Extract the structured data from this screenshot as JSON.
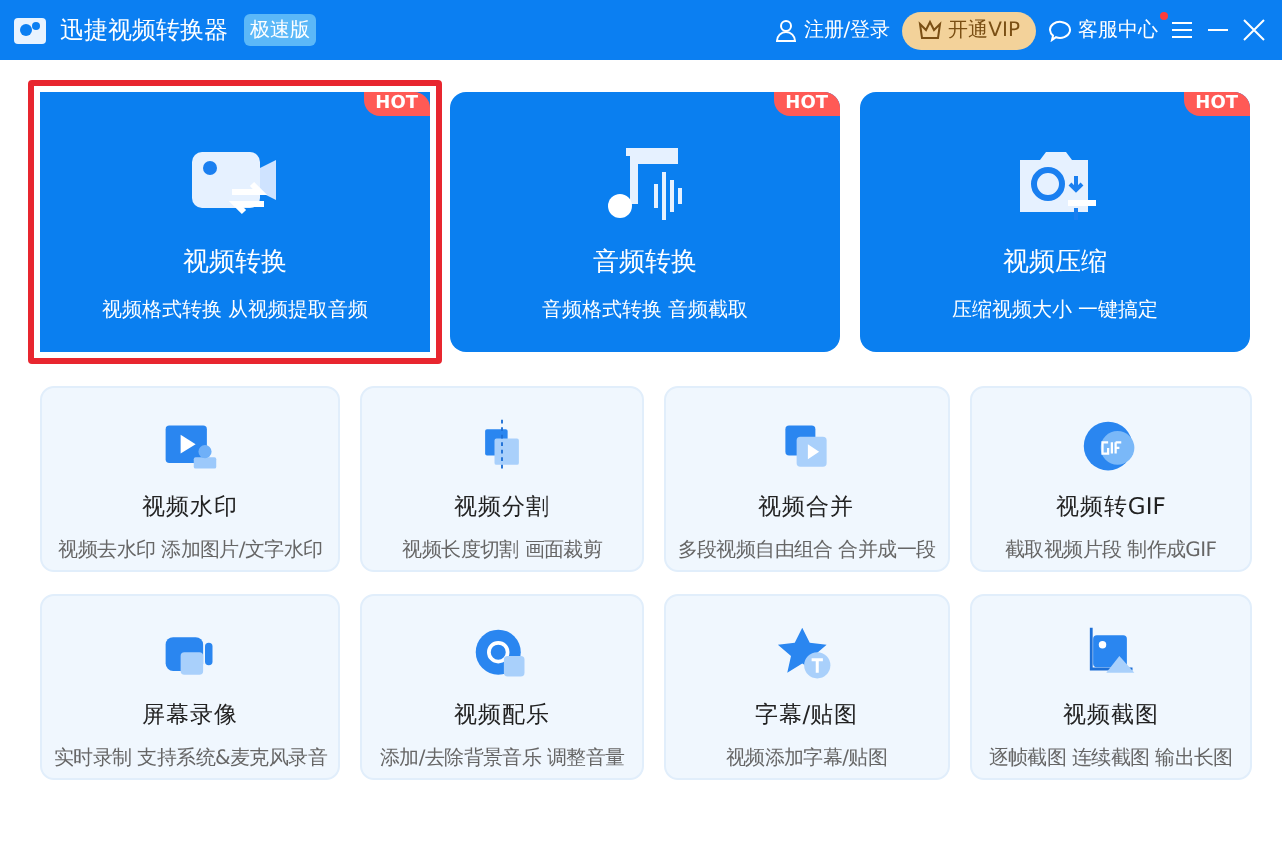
{
  "window": {
    "title": "迅捷视频转换器",
    "edition": "极速版",
    "login": "注册/登录",
    "vip": "开通VIP",
    "service": "客服中心",
    "service_dot": true
  },
  "features": [
    {
      "kind": "convert",
      "title": "视频转换",
      "subtitle": "视频格式转换 从视频提取音频",
      "badge": "HOT",
      "selected": true
    },
    {
      "kind": "audio",
      "title": "音频转换",
      "subtitle": "音频格式转换 音频截取",
      "badge": "HOT",
      "selected": false
    },
    {
      "kind": "compress",
      "title": "视频压缩",
      "subtitle": "压缩视频大小 一键搞定",
      "badge": "HOT",
      "selected": false
    }
  ],
  "tools": [
    {
      "kind": "watermark",
      "title": "视频水印",
      "subtitle": "视频去水印 添加图片/文字水印"
    },
    {
      "kind": "split",
      "title": "视频分割",
      "subtitle": "视频长度切割 画面裁剪"
    },
    {
      "kind": "merge",
      "title": "视频合并",
      "subtitle": "多段视频自由组合 合并成一段"
    },
    {
      "kind": "gif",
      "title": "视频转GIF",
      "subtitle": "截取视频片段 制作成GIF"
    },
    {
      "kind": "record",
      "title": "屏幕录像",
      "subtitle": "实时录制 支持系统&麦克风录音"
    },
    {
      "kind": "music",
      "title": "视频配乐",
      "subtitle": "添加/去除背景音乐 调整音量"
    },
    {
      "kind": "subtitle",
      "title": "字幕/贴图",
      "subtitle": "视频添加字幕/贴图"
    },
    {
      "kind": "screenshot",
      "title": "视频截图",
      "subtitle": "逐帧截图 连续截图 输出长图"
    }
  ]
}
